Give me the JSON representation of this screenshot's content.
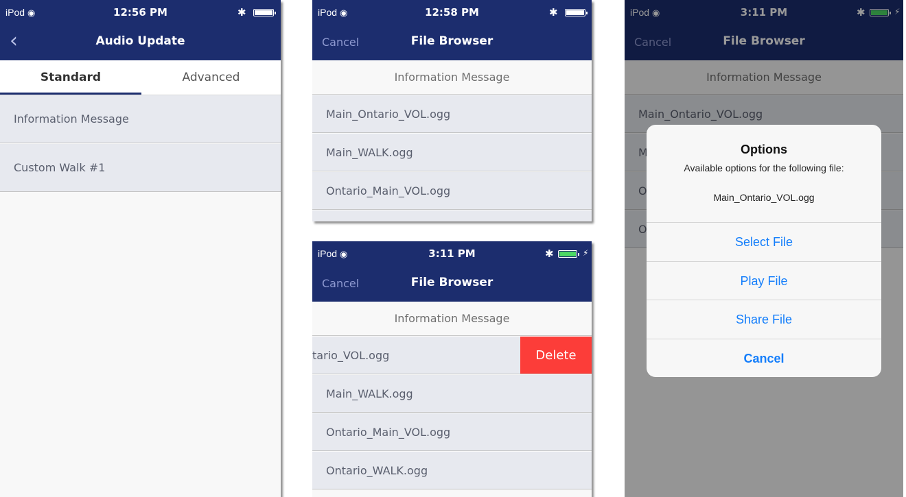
{
  "screen1": {
    "status": {
      "carrier": "iPod",
      "time": "12:56 PM"
    },
    "nav": {
      "title": "Audio Update"
    },
    "tabs": [
      "Standard",
      "Advanced"
    ],
    "rows": [
      "Information Message",
      "Custom Walk #1"
    ]
  },
  "screen2": {
    "status": {
      "carrier": "iPod",
      "time": "12:58 PM"
    },
    "nav": {
      "left": "Cancel",
      "title": "File Browser"
    },
    "section": "Information Message",
    "rows": [
      "Main_Ontario_VOL.ogg",
      "Main_WALK.ogg",
      "Ontario_Main_VOL.ogg"
    ]
  },
  "screen3": {
    "status": {
      "carrier": "iPod",
      "time": "3:11 PM"
    },
    "nav": {
      "left": "Cancel",
      "title": "File Browser"
    },
    "section": "Information Message",
    "swiped_row": "tario_VOL.ogg",
    "delete_label": "Delete",
    "rows": [
      "Main_WALK.ogg",
      "Ontario_Main_VOL.ogg",
      "Ontario_WALK.ogg"
    ]
  },
  "screen4": {
    "status": {
      "carrier": "iPod",
      "time": "3:11 PM"
    },
    "nav": {
      "left": "Cancel",
      "title": "File Browser"
    },
    "section": "Information Message",
    "rows": [
      "Main_Ontario_VOL.ogg",
      "M",
      "O",
      "O"
    ],
    "alert": {
      "title": "Options",
      "message": "Available options for the following file:",
      "file": "Main_Ontario_VOL.ogg",
      "buttons": [
        "Select File",
        "Play File",
        "Share File",
        "Cancel"
      ]
    }
  },
  "colors": {
    "navbar": "#1c2d6e",
    "row_bg": "#e7e9ef",
    "delete": "#fc3d39",
    "link": "#147efb",
    "battery_charging": "#4cd964"
  },
  "icons": [
    "wifi-icon",
    "bluetooth-icon",
    "battery-icon",
    "back-chevron-icon",
    "charging-icon"
  ]
}
